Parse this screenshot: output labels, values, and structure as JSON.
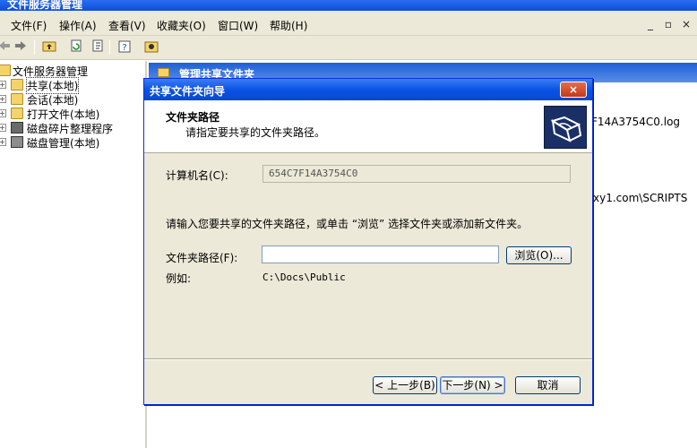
{
  "window": {
    "title": "文件服务器管理"
  },
  "menubar": {
    "items": [
      "文件(F)",
      "操作(A)",
      "查看(V)",
      "收藏夹(O)",
      "窗口(W)",
      "帮助(H)"
    ],
    "mdi_buttons": [
      "_",
      "▫",
      "×"
    ]
  },
  "toolbar": {
    "buttons": [
      "back-icon",
      "forward-icon",
      "up-folder-icon",
      "refresh-icon",
      "export-icon",
      "properties-icon",
      "help-icon"
    ]
  },
  "tree": {
    "root": "文件服务器管理",
    "items": [
      "共享(本地)",
      "会话(本地)",
      "打开文件(本地)",
      "磁盘碎片整理程序",
      "磁盘管理(本地)"
    ]
  },
  "right_pane": {
    "header": "管理共享文件夹",
    "fragment_log": "F14A3754C0.log",
    "fragment_path": "xy1.com\\SCRIPTS"
  },
  "dialog": {
    "title": "共享文件夹向导",
    "close": "×",
    "header_title": "文件夹路径",
    "header_subtitle": "请指定要共享的文件夹路径。",
    "computer_name_label": "计算机名(C):",
    "computer_name_value": "654C7F14A3754C0",
    "instruction": "请输入您要共享的文件夹路径，或单击 “浏览” 选择文件夹或添加新文件夹。",
    "folder_path_label": "文件夹路径(F):",
    "folder_path_value": "",
    "browse_button": "浏览(O)...",
    "example_label": "例如:",
    "example_value": "C:\\Docs\\Public",
    "back_button": "< 上一步(B)",
    "next_button": "下一步(N) >",
    "cancel_button": "取消"
  }
}
